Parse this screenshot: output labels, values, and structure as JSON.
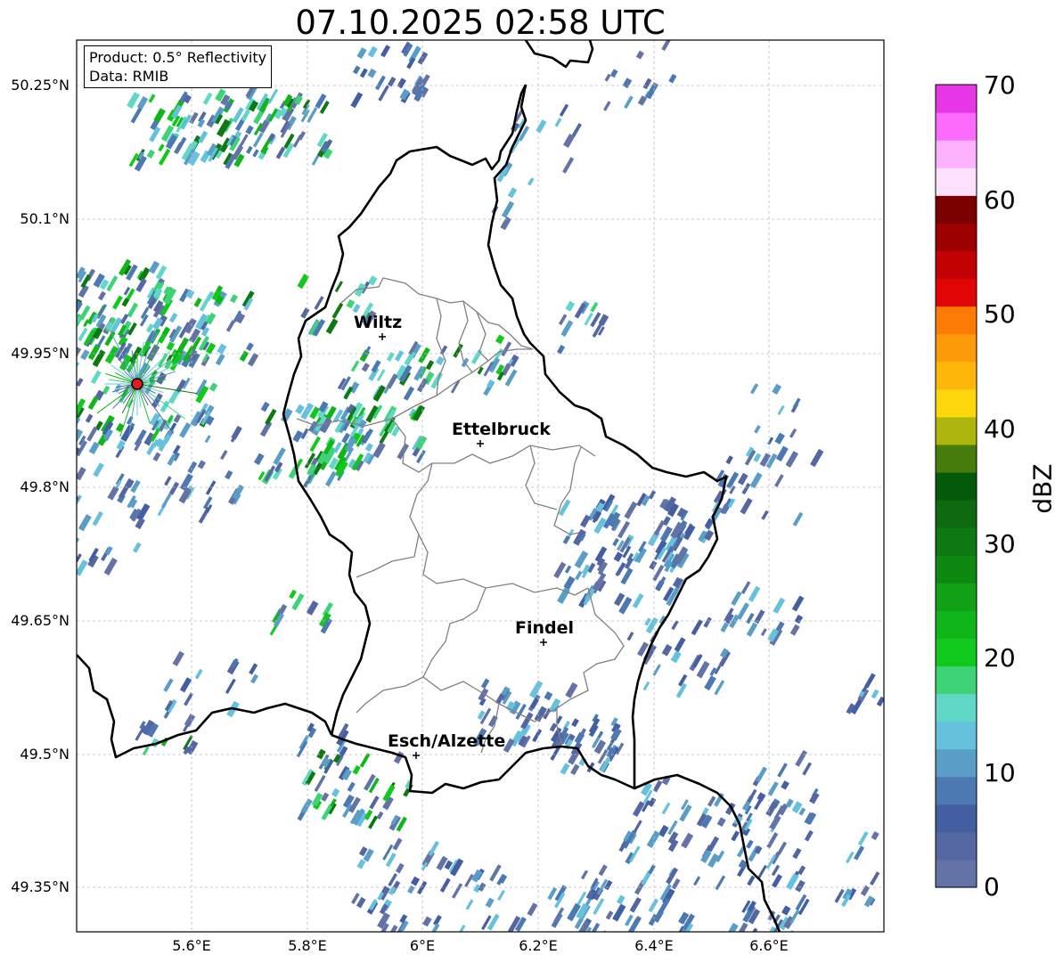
{
  "title": "07.10.2025 02:58 UTC",
  "info": {
    "product": "Product: 0.5° Reflectivity",
    "source": "Data: RMIB"
  },
  "latitude_labels": [
    "50.25°N",
    "50.1°N",
    "49.95°N",
    "49.8°N",
    "49.65°N",
    "49.5°N",
    "49.35°N"
  ],
  "longitude_labels": [
    "5.6°E",
    "5.8°E",
    "6°E",
    "6.2°E",
    "6.4°E",
    "6.6°E"
  ],
  "cities": [
    {
      "name": "Wiltz"
    },
    {
      "name": "Ettelbruck"
    },
    {
      "name": "Findel"
    },
    {
      "name": "Esch/Alzette"
    }
  ],
  "colorbar": {
    "unit": "dBZ",
    "ticks": [
      "70",
      "60",
      "50",
      "40",
      "30",
      "20",
      "10",
      "0"
    ],
    "range": [
      0,
      70
    ],
    "colors": [
      "#6373a6",
      "#5467a3",
      "#445ea2",
      "#4c79b1",
      "#5a9ec8",
      "#66c1dd",
      "#61d7c7",
      "#3ed376",
      "#11c91d",
      "#10b619",
      "#11a016",
      "#0f8812",
      "#0e7912",
      "#0d6a10",
      "#045a0a",
      "#467c0c",
      "#aeb50c",
      "#fdd70b",
      "#fcb70a",
      "#fc9a0a",
      "#fc7b07",
      "#e10506",
      "#c10103",
      "#9e0002",
      "#7b0001",
      "#fde1fd",
      "#fcb2fc",
      "#fc6cfc",
      "#e736e7"
    ],
    "color_bins_dbz": [
      0,
      2.5,
      5,
      7.5,
      10,
      12.5,
      15,
      17.5,
      20,
      22.5,
      25,
      27.5,
      30,
      32.5,
      35,
      37.5,
      40,
      42.5,
      45,
      47.5,
      50,
      52.5,
      55,
      57.5,
      60,
      62.5,
      65,
      67.5
    ]
  },
  "colors": {
    "border": "#000000",
    "district_lines": "#808080",
    "grid": "#bbbbbb",
    "radar_site": "#e5191e"
  }
}
